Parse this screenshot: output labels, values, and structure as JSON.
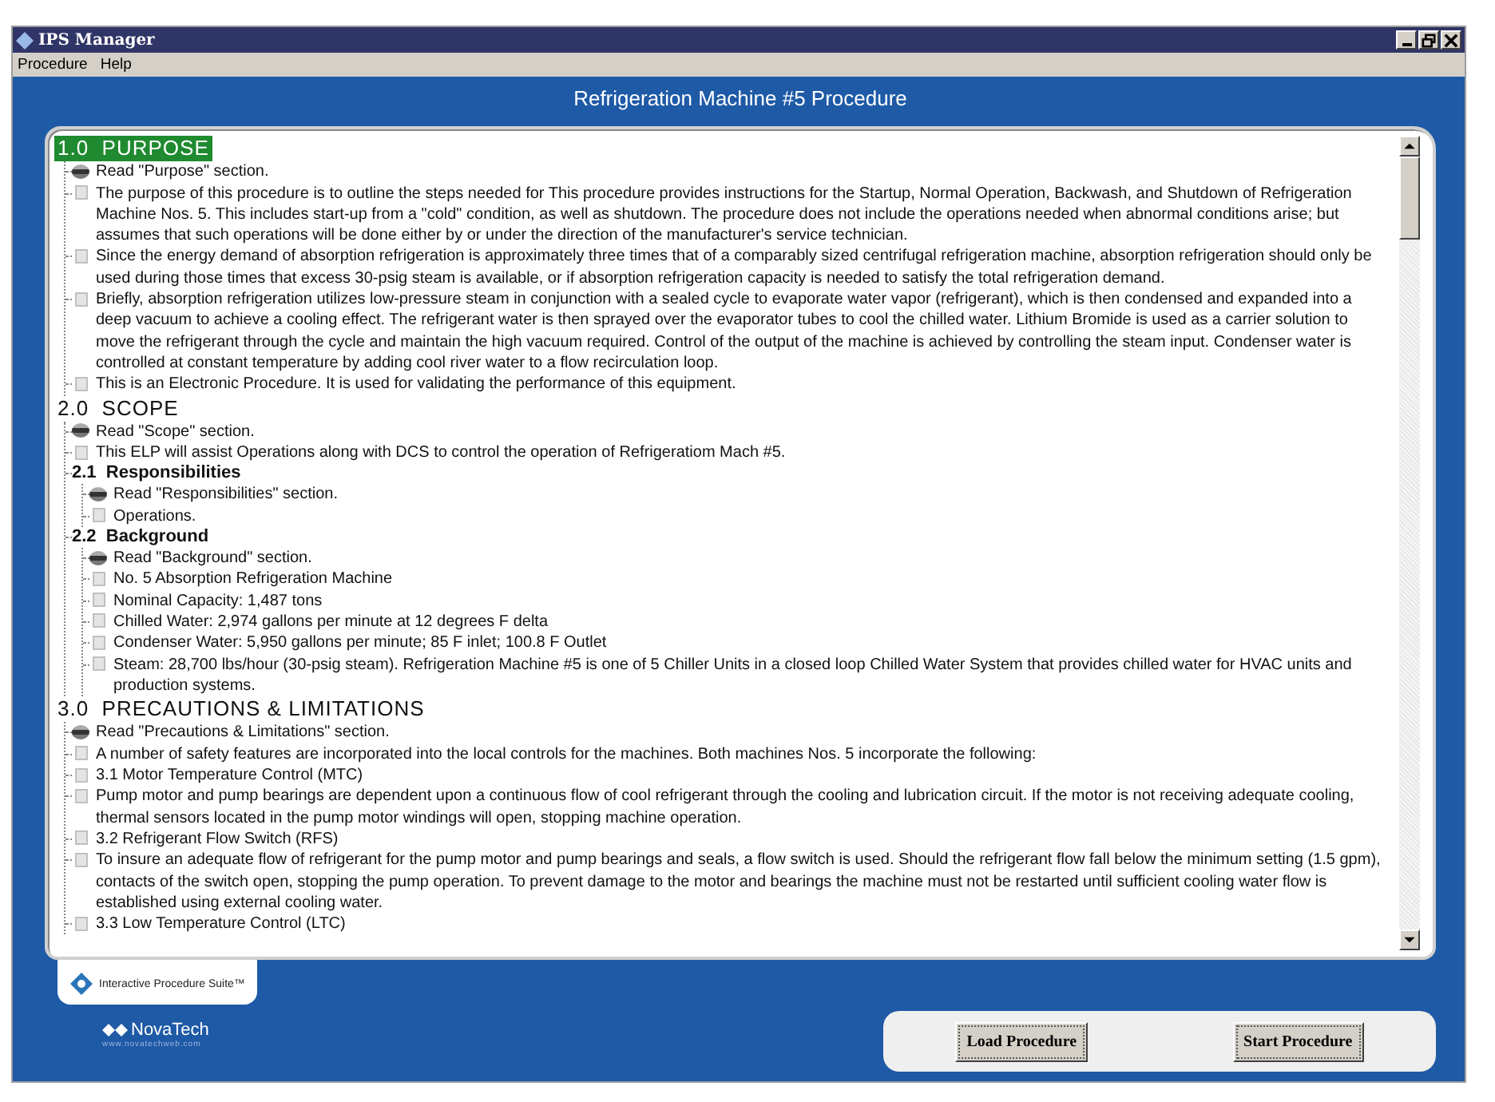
{
  "window": {
    "title": "IPS Manager"
  },
  "menu": [
    "Procedure",
    "Help"
  ],
  "header": {
    "title": "Refrigeration Machine #5 Procedure"
  },
  "sections": [
    {
      "number": "1.0",
      "title": "PURPOSE",
      "selected": true,
      "children": [
        {
          "kind": "read",
          "text": "Read \"Purpose\" section."
        },
        {
          "kind": "step",
          "checked": false,
          "text": "The purpose of this procedure is to outline the steps needed for This procedure provides instructions for the Startup, Normal Operation, Backwash, and Shutdown of Refrigeration Machine Nos. 5.  This includes start-up from a \"cold\" condition, as well as shutdown.  The procedure does not include the operations needed when abnormal conditions arise; but assumes that such operations will be done either by or under the direction of the manufacturer's service technician."
        },
        {
          "kind": "step",
          "checked": false,
          "text": "Since the energy demand of absorption refrigeration is approximately three times that of a comparably sized centrifugal refrigeration machine, absorption refrigeration should only be used during those times that excess 30-psig steam is available, or if absorption refrigeration capacity is needed to satisfy the total refrigeration demand."
        },
        {
          "kind": "step",
          "checked": false,
          "text": "Briefly, absorption refrigeration utilizes low-pressure steam in conjunction with a sealed cycle to evaporate water vapor (refrigerant), which is then condensed and expanded into a deep vacuum to achieve a cooling effect.  The refrigerant water is then sprayed over the evaporator tubes to cool the chilled water.  Lithium Bromide is used as a carrier solution to move the refrigerant through the cycle and maintain the high vacuum required.  Control of the output of the machine is achieved by controlling the steam input. Condenser water is controlled at constant temperature by adding cool river water to a flow recirculation loop."
        },
        {
          "kind": "step",
          "checked": false,
          "text": "This is an Electronic Procedure.  It is used for validating the performance of this equipment."
        }
      ]
    },
    {
      "number": "2.0",
      "title": "SCOPE",
      "selected": false,
      "children": [
        {
          "kind": "read",
          "text": "Read \"Scope\" section."
        },
        {
          "kind": "step",
          "checked": false,
          "text": "This ELP will assist Operations along with DCS to control the operation of Refrigeratiom Mach #5."
        },
        {
          "kind": "subsection",
          "number": "2.1",
          "title": "Responsibilities",
          "children": [
            {
              "kind": "read",
              "text": "Read \"Responsibilities\" section."
            },
            {
              "kind": "step",
              "checked": false,
              "text": "Operations."
            }
          ]
        },
        {
          "kind": "subsection",
          "number": "2.2",
          "title": "Background",
          "children": [
            {
              "kind": "read",
              "text": "Read \"Background\" section."
            },
            {
              "kind": "step",
              "checked": false,
              "text": "No. 5 Absorption Refrigeration Machine"
            },
            {
              "kind": "step",
              "checked": false,
              "text": "Nominal Capacity: 1,487 tons"
            },
            {
              "kind": "step",
              "checked": false,
              "text": "Chilled Water: 2,974 gallons per minute at 12 degrees F delta"
            },
            {
              "kind": "step",
              "checked": false,
              "text": "Condenser Water: 5,950 gallons per minute; 85 F inlet; 100.8 F Outlet"
            },
            {
              "kind": "step",
              "checked": false,
              "text": "Steam:  28,700 lbs/hour (30-psig steam). Refrigeration Machine #5 is one of 5 Chiller Units in a closed loop Chilled Water System  that provides chilled water for HVAC units and production systems."
            }
          ]
        }
      ]
    },
    {
      "number": "3.0",
      "title": "PRECAUTIONS & LIMITATIONS",
      "selected": false,
      "children": [
        {
          "kind": "read",
          "text": "Read \"Precautions & Limitations\" section."
        },
        {
          "kind": "step",
          "checked": false,
          "text": "A number of safety features are incorporated into the local controls for the machines.  Both machines Nos. 5 incorporate the following:"
        },
        {
          "kind": "step",
          "checked": false,
          "text": "3.1  Motor Temperature Control (MTC)"
        },
        {
          "kind": "step",
          "checked": false,
          "text": "Pump motor and pump bearings are dependent upon a continuous flow of cool refrigerant through the cooling and lubrication circuit.  If the motor is not receiving adequate cooling, thermal sensors located in the pump motor windings will open, stopping machine operation."
        },
        {
          "kind": "step",
          "checked": false,
          "text": "3.2  Refrigerant Flow Switch (RFS)"
        },
        {
          "kind": "step",
          "checked": false,
          "text": "To insure an adequate flow of refrigerant for the pump motor and pump bearings and seals, a flow switch is used.  Should the refrigerant flow fall below the minimum setting (1.5 gpm), contacts of the switch open, stopping the pump operation.  To prevent damage to the motor and bearings the machine must not be restarted until sufficient cooling water flow is established using external cooling water."
        },
        {
          "kind": "step",
          "checked": false,
          "text": "3.3  Low Temperature Control (LTC)"
        }
      ]
    }
  ],
  "brand": {
    "suite": "Interactive Procedure Suite™",
    "logo": "NovaTech",
    "url": "www.novatechweb.com"
  },
  "buttons": [
    "Load Procedure",
    "Start Procedure"
  ]
}
